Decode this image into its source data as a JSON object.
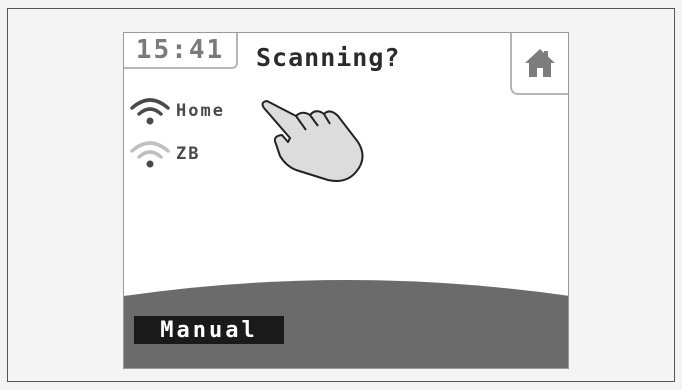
{
  "device": {
    "clock": "15:41",
    "title": "Scanning?"
  },
  "networks": [
    {
      "name": "Home",
      "icon": "wifi-strong-icon"
    },
    {
      "name": "ZB",
      "icon": "wifi-weak-icon"
    }
  ],
  "footer": {
    "manual_label": "Manual"
  },
  "icons": {
    "home": "home-icon",
    "pointer": "pointing-hand-icon"
  },
  "colors": {
    "bottom_bar": "#6b6b6b",
    "manual_button": "#1a1a1a",
    "home_icon": "#7d7d7d",
    "wifi_weak": "#c0c0c0",
    "wifi_strong": "#4a4a4a"
  }
}
